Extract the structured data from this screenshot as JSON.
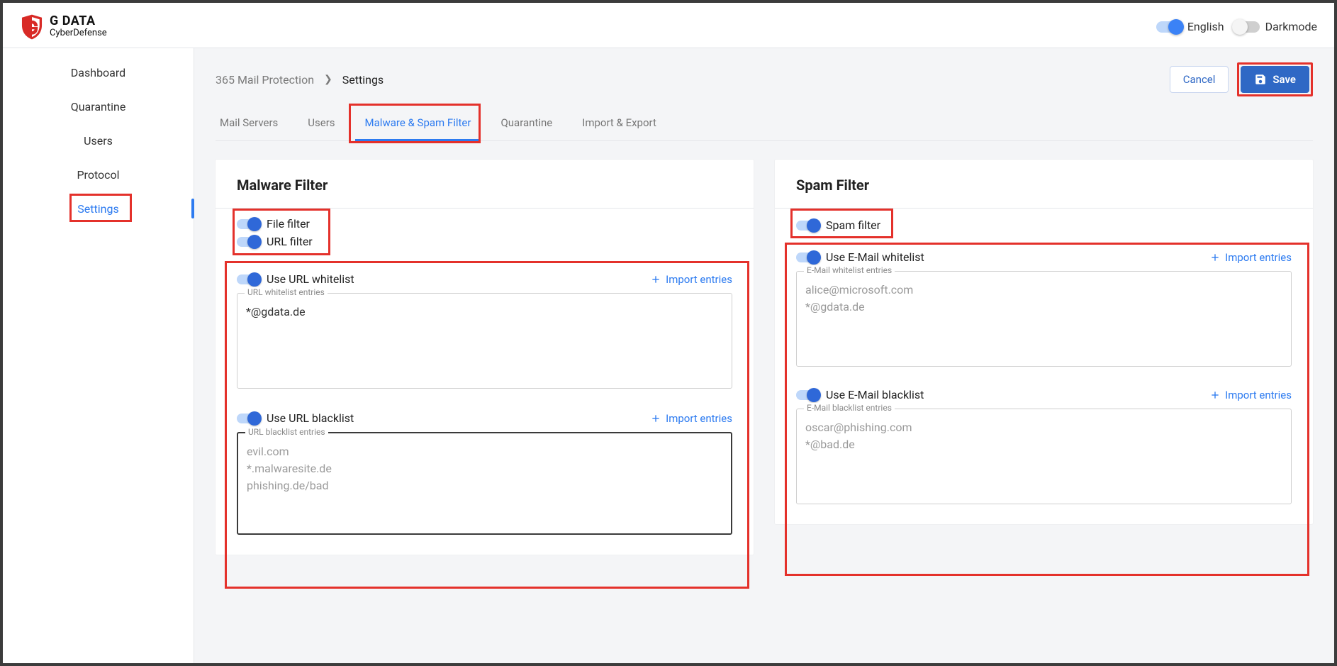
{
  "brand": {
    "name": "G DATA",
    "sub": "CyberDefense"
  },
  "header": {
    "language_label": "English",
    "dark_label": "Darkmode"
  },
  "sidebar": {
    "items": [
      {
        "id": "dashboard",
        "label": "Dashboard",
        "active": false
      },
      {
        "id": "quarantine",
        "label": "Quarantine",
        "active": false
      },
      {
        "id": "users",
        "label": "Users",
        "active": false
      },
      {
        "id": "protocol",
        "label": "Protocol",
        "active": false
      },
      {
        "id": "settings",
        "label": "Settings",
        "active": true
      }
    ]
  },
  "breadcrumb": {
    "root": "365 Mail Protection",
    "current": "Settings"
  },
  "actions": {
    "cancel": "Cancel",
    "save": "Save"
  },
  "tabs": [
    {
      "id": "mail-servers",
      "label": "Mail Servers"
    },
    {
      "id": "users",
      "label": "Users"
    },
    {
      "id": "malware-spam",
      "label": "Malware & Spam Filter",
      "active": true
    },
    {
      "id": "quarantine",
      "label": "Quarantine"
    },
    {
      "id": "import-export",
      "label": "Import & Export"
    }
  ],
  "malware": {
    "title": "Malware Filter",
    "file_filter_label": "File filter",
    "url_filter_label": "URL filter",
    "use_url_whitelist_label": "Use URL whitelist",
    "use_url_blacklist_label": "Use URL blacklist",
    "import_label": "Import entries",
    "whitelist_legend": "URL whitelist entries",
    "blacklist_legend": "URL blacklist entries",
    "whitelist_value": "*@gdata.de",
    "blacklist_placeholder": [
      "evil.com",
      "*.malwaresite.de",
      "phishing.de/bad"
    ]
  },
  "spam": {
    "title": "Spam Filter",
    "spam_filter_label": "Spam filter",
    "use_email_whitelist_label": "Use E-Mail whitelist",
    "use_email_blacklist_label": "Use E-Mail blacklist",
    "import_label": "Import entries",
    "whitelist_legend": "E-Mail whitelist entries",
    "blacklist_legend": "E-Mail blacklist entries",
    "whitelist_placeholder": [
      "alice@microsoft.com",
      "*@gdata.de"
    ],
    "blacklist_placeholder": [
      "oscar@phishing.com",
      "*@bad.de"
    ]
  }
}
